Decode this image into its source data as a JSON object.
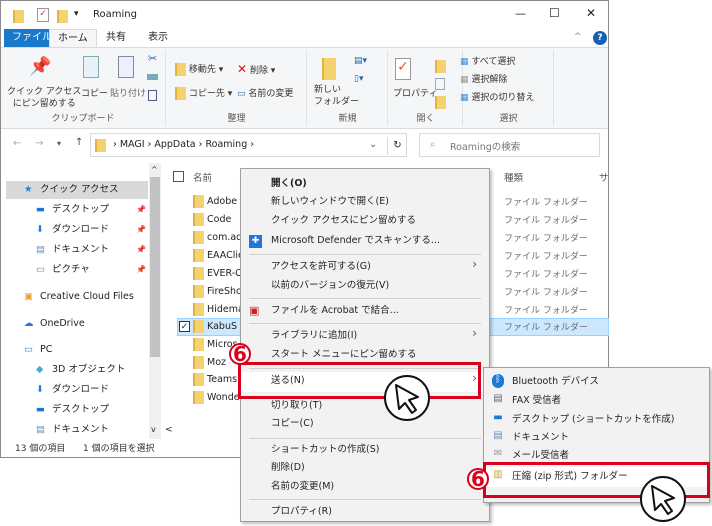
{
  "window": {
    "title": "Roaming",
    "minimize": "—",
    "maximize": "☐",
    "close": "✕",
    "help": "?"
  },
  "tabs": [
    "ファイル",
    "ホーム",
    "共有",
    "表示"
  ],
  "ribbon": {
    "clipboard": {
      "pin": "クイック アクセス\nにピン留めする",
      "copy": "コピー",
      "paste": "貼り付け",
      "label": "クリップボード"
    },
    "organize": {
      "move": "移動先 ▾",
      "copyto": "コピー先 ▾",
      "delete": "削除 ▾",
      "rename": "名前の変更",
      "label": "整理"
    },
    "new": {
      "newfolder": "新しい\nフォルダー",
      "label": "新規"
    },
    "open": {
      "properties": "プロパティ",
      "label": "開く"
    },
    "select": {
      "all": "すべて選択",
      "none": "選択解除",
      "invert": "選択の切り替え",
      "label": "選択"
    }
  },
  "address": {
    "path": [
      "MAGI",
      "AppData",
      "Roaming"
    ],
    "search_placeholder": "Roamingの検索"
  },
  "nav": [
    {
      "label": "クイック アクセス",
      "icon": "star-icon",
      "selected": true
    },
    {
      "label": "デスクトップ",
      "icon": "desktop-icon",
      "pinned": true
    },
    {
      "label": "ダウンロード",
      "icon": "download-icon",
      "pinned": true
    },
    {
      "label": "ドキュメント",
      "icon": "document-icon",
      "pinned": true
    },
    {
      "label": "ピクチャ",
      "icon": "picture-icon",
      "pinned": true
    },
    {
      "label": "Creative Cloud Files",
      "icon": "creative-cloud-icon"
    },
    {
      "label": "OneDrive",
      "icon": "cloud-icon"
    },
    {
      "label": "PC",
      "icon": "pc-icon"
    },
    {
      "label": "3D オブジェクト",
      "icon": "3d-icon"
    },
    {
      "label": "ダウンロード",
      "icon": "download-icon"
    },
    {
      "label": "デスクトップ",
      "icon": "desktop-icon"
    },
    {
      "label": "ドキュメント",
      "icon": "document-icon"
    }
  ],
  "list": {
    "col_name": "名前",
    "col_type": "種類",
    "col_size": "サ",
    "files": [
      "Adobe",
      "Code",
      "com.ado",
      "EAAClie",
      "EVER-Cl",
      "FireShot",
      "Hidema",
      "KabuS",
      "Micros",
      "Moz",
      "Teams",
      "Wonde"
    ],
    "type": "ファイル フォルダー",
    "selected": "KabuS"
  },
  "status": {
    "count": "13 個の項目",
    "selected": "1 個の項目を選択"
  },
  "context_menu": [
    "開く(O)",
    "新しいウィンドウで開く(E)",
    "クイック アクセスにピン留めする",
    "Microsoft Defender でスキャンする...",
    "アクセスを許可する(G)",
    "以前のバージョンの復元(V)",
    "ファイルを Acrobat で結合...",
    "ライブラリに追加(I)",
    "スタート メニューにピン留めする",
    "送る(N)",
    "切り取り(T)",
    "コピー(C)",
    "ショートカットの作成(S)",
    "削除(D)",
    "名前の変更(M)",
    "プロパティ(R)"
  ],
  "send_to": [
    "Bluetooth デバイス",
    "FAX 受信者",
    "デスクトップ (ショートカットを作成)",
    "ドキュメント",
    "メール受信者",
    "圧縮 (zip 形式) フォルダー"
  ],
  "step": "6",
  "colors": {
    "accent": "#1979ca",
    "highlight": "#cce8ff",
    "annotation": "#d9001b"
  }
}
